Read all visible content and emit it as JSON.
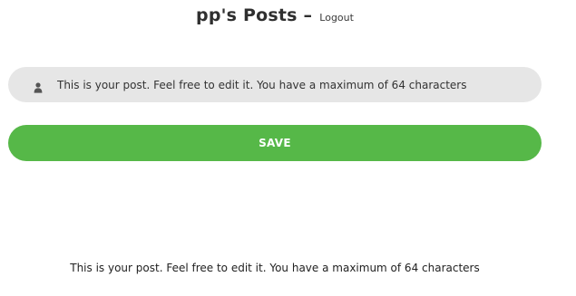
{
  "header": {
    "title": "pp's Posts –",
    "logout_label": "Logout"
  },
  "post_form": {
    "input_value": "This is your post. Feel free to edit it. You have a maximum of 64 characters",
    "input_icon": "user-icon",
    "save_label": "SAVE"
  },
  "post": {
    "text": "This is your post. Feel free to edit it. You have a maximum of 64 characters"
  },
  "colors": {
    "accent": "#56b848",
    "input_background": "#e6e6e6"
  }
}
